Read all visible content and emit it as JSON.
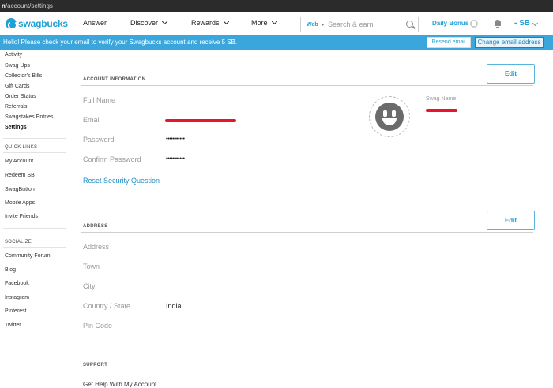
{
  "browser": {
    "url_prefix": "n",
    "url_path": "/account/settings"
  },
  "nav": {
    "logo_text": "swagbucks",
    "items": [
      {
        "label": "Answer"
      },
      {
        "label": "Discover"
      },
      {
        "label": "Rewards"
      },
      {
        "label": "More"
      }
    ],
    "search": {
      "scope": "Web",
      "placeholder": "Search & earn"
    },
    "daily_bonus": "Daily Bonus",
    "balance": "- SB"
  },
  "alert": {
    "message": "Hello! Please check your email to verify your Swagbucks account and receive 5 SB.",
    "resend_label": "Resend email",
    "change_label": "Change email address"
  },
  "sidebar": {
    "account_items": [
      {
        "label": "Activity"
      },
      {
        "label": "Swag Ups"
      },
      {
        "label": "Collector's Bills"
      },
      {
        "label": "Gift Cards"
      },
      {
        "label": "Order Status"
      },
      {
        "label": "Referrals"
      },
      {
        "label": "Swagstakes Entries"
      },
      {
        "label": "Settings"
      }
    ],
    "quick_links_heading": "QUICK LINKS",
    "quick_links": [
      {
        "label": "My Account"
      },
      {
        "label": "Redeem SB"
      },
      {
        "label": "SwagButton"
      },
      {
        "label": "Mobile Apps"
      },
      {
        "label": "Invite Friends"
      }
    ],
    "socialize_heading": "SOCIALIZE",
    "socialize": [
      {
        "label": "Community Forum"
      },
      {
        "label": "Blog"
      },
      {
        "label": "Facebook"
      },
      {
        "label": "Instagram"
      },
      {
        "label": "Pinterest"
      },
      {
        "label": "Twitter"
      }
    ]
  },
  "account_info": {
    "heading": "ACCOUNT INFORMATION",
    "edit_label": "Edit",
    "full_name_label": "Full Name",
    "email_label": "Email",
    "password_label": "Password",
    "password_value": "•••••••••••",
    "confirm_password_label": "Confirm Password",
    "confirm_password_value": "•••••••••••",
    "reset_security_label": "Reset Security Question",
    "swag_name_label": "Swag Name"
  },
  "address": {
    "heading": "ADDRESS",
    "edit_label": "Edit",
    "address_label": "Address",
    "town_label": "Town",
    "city_label": "City",
    "country_state_label": "Country / State",
    "country_state_value": "India",
    "pin_code_label": "Pin Code"
  },
  "support": {
    "heading": "SUPPORT",
    "help_label": "Get Help With My Account"
  },
  "colors": {
    "brand": "#1fa0d6",
    "alert_bg": "#3ba6dc",
    "redaction": "#e8152b"
  }
}
